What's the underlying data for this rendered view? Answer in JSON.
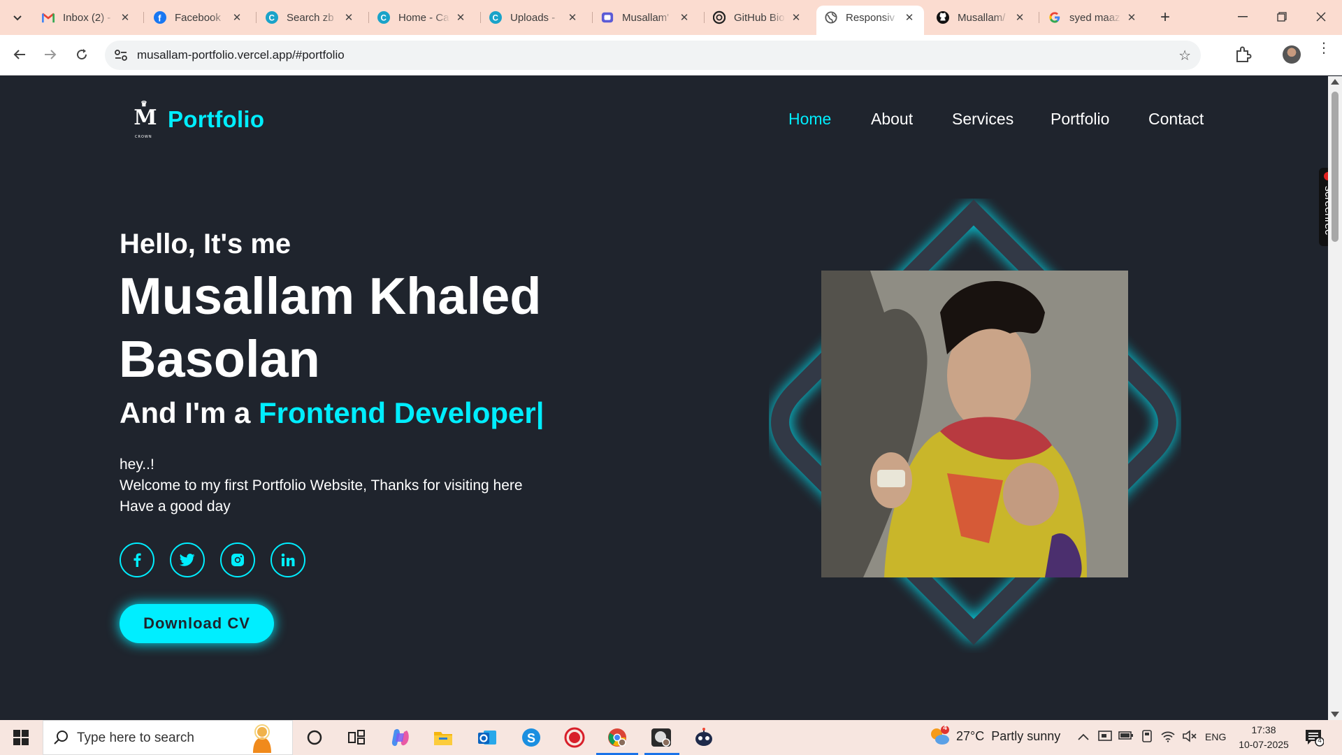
{
  "browser": {
    "tabs": [
      {
        "title": "Inbox (2) -",
        "icon": "gmail-icon"
      },
      {
        "title": "Facebook",
        "icon": "facebook-icon"
      },
      {
        "title": "Search zb",
        "icon": "canva-icon"
      },
      {
        "title": "Home - Ca",
        "icon": "canva-icon"
      },
      {
        "title": "Uploads - ",
        "icon": "canva-icon"
      },
      {
        "title": "Musallam'",
        "icon": "app-icon"
      },
      {
        "title": "GitHub Bio",
        "icon": "chatgpt-icon"
      },
      {
        "title": "Responsiv",
        "icon": "globe-icon"
      },
      {
        "title": "Musallam/",
        "icon": "github-icon"
      },
      {
        "title": "syed maaz",
        "icon": "google-icon"
      }
    ],
    "active_tab": 7,
    "url": "musallam-portfolio.vercel.app/#portfolio"
  },
  "site": {
    "logo_text": "Portfolio",
    "logo_mark": "M",
    "logo_sub": "CROWN",
    "nav": [
      "Home",
      "About",
      "Services",
      "Portfolio",
      "Contact"
    ],
    "nav_active": "Home",
    "hello": "Hello, It's me",
    "name": "Musallam Khaled Basolan",
    "role_prefix": "And I'm a ",
    "role": "Frontend Developer",
    "cursor": "|",
    "intro": [
      "hey..!",
      "Welcome to my first Portfolio Website, Thanks for visiting here",
      "Have a good day"
    ],
    "socials": [
      {
        "name": "facebook",
        "glyph": "f"
      },
      {
        "name": "twitter",
        "glyph": "t"
      },
      {
        "name": "instagram",
        "glyph": "ig"
      },
      {
        "name": "linkedin",
        "glyph": "in"
      }
    ],
    "cv_button": "Download CV",
    "accent": "#00eeff",
    "background": "#1f242d"
  },
  "screenrec": {
    "label": "screenrec"
  },
  "taskbar": {
    "search_placeholder": "Type here to search",
    "weather": {
      "temp": "27°C",
      "condition": "Partly sunny",
      "badge": "4"
    },
    "lang": "ENG",
    "time": "17:38",
    "date": "10-07-2025",
    "notifications": "4",
    "pinned": [
      "cortana-icon",
      "task-view-icon",
      "copilot-icon",
      "file-explorer-icon",
      "outlook-icon",
      "skype-icon",
      "recorder-icon",
      "chrome-icon",
      "app-icon",
      "bot-icon"
    ]
  }
}
